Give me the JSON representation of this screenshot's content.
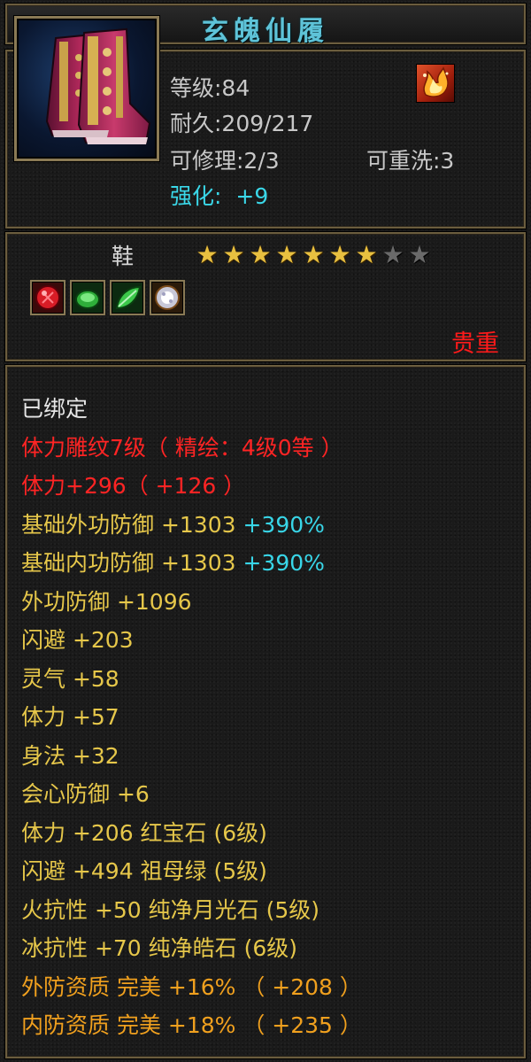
{
  "item": {
    "name": "玄魄仙履",
    "level": "等级:84",
    "durability": "耐久:209/217",
    "repair": "可修理:2/3",
    "rewash": "可重洗:3",
    "enhance_label": "强化:",
    "enhance_value": "+9",
    "slot_type": "鞋",
    "quality": "贵重",
    "stars": {
      "filled": 7,
      "total": 9
    },
    "badge_icon": "flame-emblem-icon",
    "item_icon": "boots-icon"
  },
  "gems": [
    {
      "icon": "ruby-gem-icon",
      "color": "#e0202a"
    },
    {
      "icon": "emerald-gem-icon",
      "color": "#2fae3a"
    },
    {
      "icon": "jade-leaf-gem-icon",
      "color": "#3cc84a"
    },
    {
      "icon": "diamond-gem-icon",
      "color": "#d8d8e8"
    }
  ],
  "colors": {
    "title": "#5ec3d8",
    "red": "#ff2424",
    "yellow": "#e6c74a",
    "cyan": "#38d6e8",
    "orange": "#f0a01e",
    "white": "#e6e6e6"
  },
  "attributes": [
    {
      "parts": [
        {
          "text": "已绑定",
          "color": "white"
        }
      ]
    },
    {
      "parts": [
        {
          "text": "体力雕纹7级（ 精绘：4级0等 ）",
          "color": "red"
        }
      ]
    },
    {
      "parts": [
        {
          "text": "体力+296（ +126 ）",
          "color": "red"
        }
      ]
    },
    {
      "parts": [
        {
          "text": "基础外功防御 +1303 ",
          "color": "yellow"
        },
        {
          "text": "+390%",
          "color": "cyan"
        }
      ]
    },
    {
      "parts": [
        {
          "text": "基础内功防御 +1303 ",
          "color": "yellow"
        },
        {
          "text": "+390%",
          "color": "cyan"
        }
      ]
    },
    {
      "parts": [
        {
          "text": "外功防御 +1096",
          "color": "yellow"
        }
      ]
    },
    {
      "parts": [
        {
          "text": "闪避 +203",
          "color": "yellow"
        }
      ]
    },
    {
      "parts": [
        {
          "text": "灵气 +58",
          "color": "yellow"
        }
      ]
    },
    {
      "parts": [
        {
          "text": "体力 +57",
          "color": "yellow"
        }
      ]
    },
    {
      "parts": [
        {
          "text": "身法 +32",
          "color": "yellow"
        }
      ]
    },
    {
      "parts": [
        {
          "text": "会心防御 +6",
          "color": "yellow"
        }
      ]
    },
    {
      "parts": [
        {
          "text": "体力 +206 红宝石 (6级)",
          "color": "yellow"
        }
      ]
    },
    {
      "parts": [
        {
          "text": "闪避 +494 祖母绿 (5级)",
          "color": "yellow"
        }
      ]
    },
    {
      "parts": [
        {
          "text": "火抗性 +50 纯净月光石 (5级)",
          "color": "yellow"
        }
      ]
    },
    {
      "parts": [
        {
          "text": "冰抗性 +70 纯净皓石 (6级)",
          "color": "yellow"
        }
      ]
    },
    {
      "parts": [
        {
          "text": "外防资质  完美 +16% （ +208 ）",
          "color": "orange"
        }
      ]
    },
    {
      "parts": [
        {
          "text": "内防资质  完美 +18% （ +235 ）",
          "color": "orange"
        }
      ]
    }
  ]
}
